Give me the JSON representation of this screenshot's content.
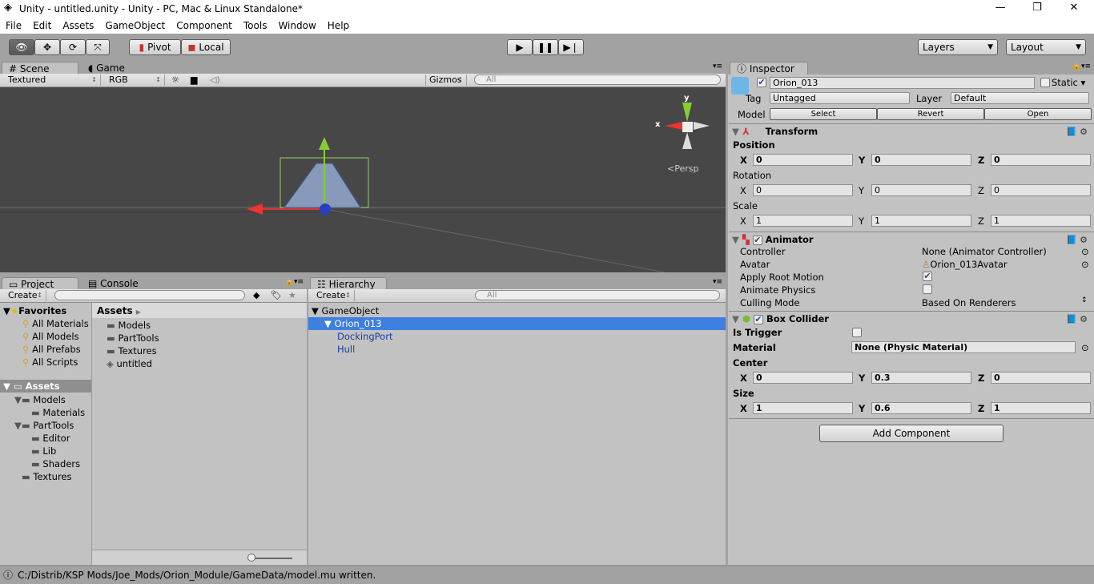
{
  "window": {
    "title": "Unity - untitled.unity - Unity - PC, Mac & Linux Standalone*",
    "minimize": "—",
    "maximize": "❐",
    "close": "✕"
  },
  "menu": [
    "File",
    "Edit",
    "Assets",
    "GameObject",
    "Component",
    "Tools",
    "Window",
    "Help"
  ],
  "toolbar": {
    "pivot": "Pivot",
    "local": "Local",
    "layers": "Layers",
    "layout": "Layout"
  },
  "scene": {
    "tabs": [
      "Scene",
      "Game"
    ],
    "shading": "Textured",
    "render_mode": "RGB",
    "gizmos": "Gizmos",
    "search_placeholder": "All",
    "persp": "Persp",
    "axis_x": "x",
    "axis_y": "y"
  },
  "project": {
    "tabs": [
      "Project",
      "Console"
    ],
    "create": "Create",
    "favorites_label": "Favorites",
    "favorites": [
      "All Materials",
      "All Models",
      "All Prefabs",
      "All Scripts"
    ],
    "tree": {
      "root": "Assets",
      "items": [
        {
          "label": "Models",
          "depth": 1
        },
        {
          "label": "Materials",
          "depth": 2
        },
        {
          "label": "PartTools",
          "depth": 1
        },
        {
          "label": "Editor",
          "depth": 2
        },
        {
          "label": "Lib",
          "depth": 2
        },
        {
          "label": "Shaders",
          "depth": 2
        },
        {
          "label": "Textures",
          "depth": 1
        }
      ]
    },
    "breadcrumb": "Assets",
    "assets": [
      {
        "label": "Models",
        "icon": "folder"
      },
      {
        "label": "PartTools",
        "icon": "folder"
      },
      {
        "label": "Textures",
        "icon": "folder"
      },
      {
        "label": "untitled",
        "icon": "unity-scene"
      }
    ]
  },
  "hierarchy": {
    "tab": "Hierarchy",
    "create": "Create",
    "search_placeholder": "All",
    "items": [
      {
        "label": "GameObject",
        "depth": 0
      },
      {
        "label": "Orion_013",
        "depth": 1,
        "selected": true
      },
      {
        "label": "DockingPort",
        "depth": 2
      },
      {
        "label": "Hull",
        "depth": 2
      }
    ]
  },
  "inspector": {
    "tab": "Inspector",
    "name": "Orion_013",
    "active": true,
    "static_label": "Static",
    "tag_label": "Tag",
    "tag": "Untagged",
    "layer_label": "Layer",
    "layer": "Default",
    "model_label": "Model",
    "model_buttons": [
      "Select",
      "Revert",
      "Open"
    ],
    "transform": {
      "title": "Transform",
      "position_label": "Position",
      "rotation_label": "Rotation",
      "scale_label": "Scale",
      "position": [
        "0",
        "0",
        "0"
      ],
      "rotation": [
        "0",
        "0",
        "0"
      ],
      "scale": [
        "1",
        "1",
        "1"
      ]
    },
    "animator": {
      "title": "Animator",
      "enabled": true,
      "controller_label": "Controller",
      "controller": "None (Animator Controller)",
      "avatar_label": "Avatar",
      "avatar": "Orion_013Avatar",
      "apply_root_motion_label": "Apply Root Motion",
      "apply_root_motion": true,
      "animate_physics_label": "Animate Physics",
      "animate_physics": false,
      "culling_mode_label": "Culling Mode",
      "culling_mode": "Based On Renderers"
    },
    "box_collider": {
      "title": "Box Collider",
      "enabled": true,
      "is_trigger_label": "Is Trigger",
      "is_trigger": false,
      "material_label": "Material",
      "material": "None (Physic Material)",
      "center_label": "Center",
      "size_label": "Size",
      "center": [
        "0",
        "0.3",
        "0"
      ],
      "size": [
        "1",
        "0.6",
        "1"
      ]
    },
    "add_component": "Add Component",
    "axes": [
      "X",
      "Y",
      "Z"
    ]
  },
  "status": {
    "message": "C:/Distrib/KSP Mods/Joe_Mods/Orion_Module/GameData/model.mu written."
  },
  "colors": {
    "selection": "#3d80df",
    "scene_bg": "#474747",
    "panel_bg": "#c2c2c2"
  }
}
